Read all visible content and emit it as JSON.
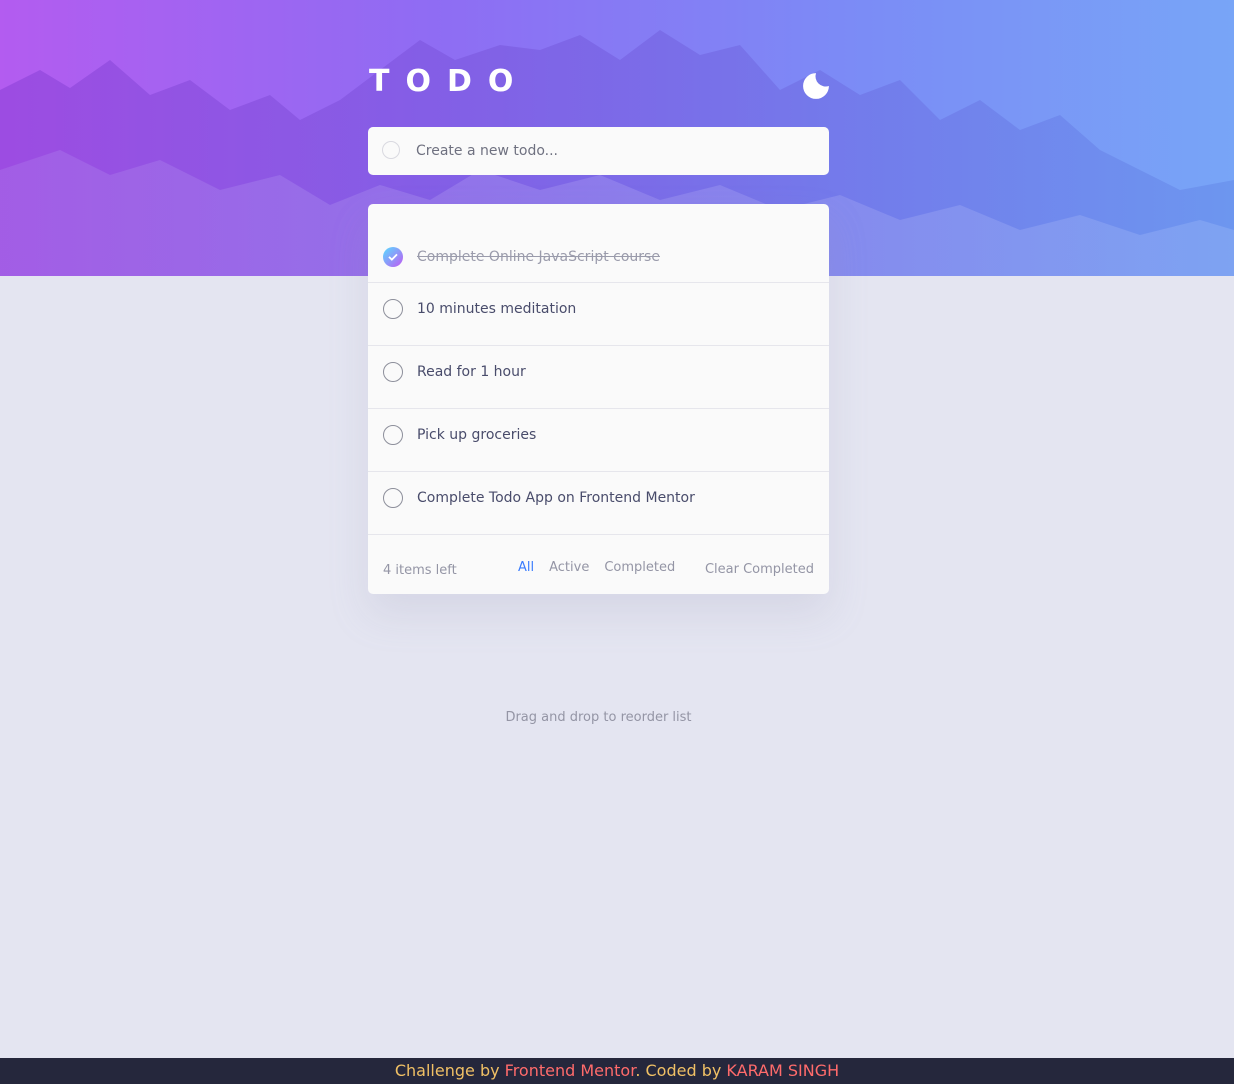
{
  "header": {
    "title": "TODO",
    "theme_toggle_icon": "moon-icon"
  },
  "create": {
    "placeholder": "Create a new todo..."
  },
  "todos": [
    {
      "text": "Complete Online JavaScript course",
      "completed": true
    },
    {
      "text": "10 minutes meditation",
      "completed": false
    },
    {
      "text": "Read for 1 hour",
      "completed": false
    },
    {
      "text": "Pick up groceries",
      "completed": false
    },
    {
      "text": "Complete Todo App on Frontend Mentor",
      "completed": false
    }
  ],
  "footer": {
    "items_left": "4 items left",
    "filters": {
      "all": "All",
      "active": "Active",
      "completed": "Completed"
    },
    "active_filter": "all",
    "clear_completed": "Clear Completed"
  },
  "hint": "Drag and drop to reorder list",
  "attribution": {
    "challenge_prefix": "Challenge by ",
    "challenge_link": "Frontend Mentor",
    "coded_prefix": ". Coded by ",
    "coded_link": "KARAM SINGH"
  },
  "colors": {
    "bright_blue": "#3a7cfd",
    "check_gradient_start": "#57ddff",
    "check_gradient_end": "#c058f3",
    "attribution_text": "#f0c065",
    "attribution_link": "#ff6b6b",
    "page_background": "#e4e5f1",
    "card_background": "#fafafa"
  }
}
